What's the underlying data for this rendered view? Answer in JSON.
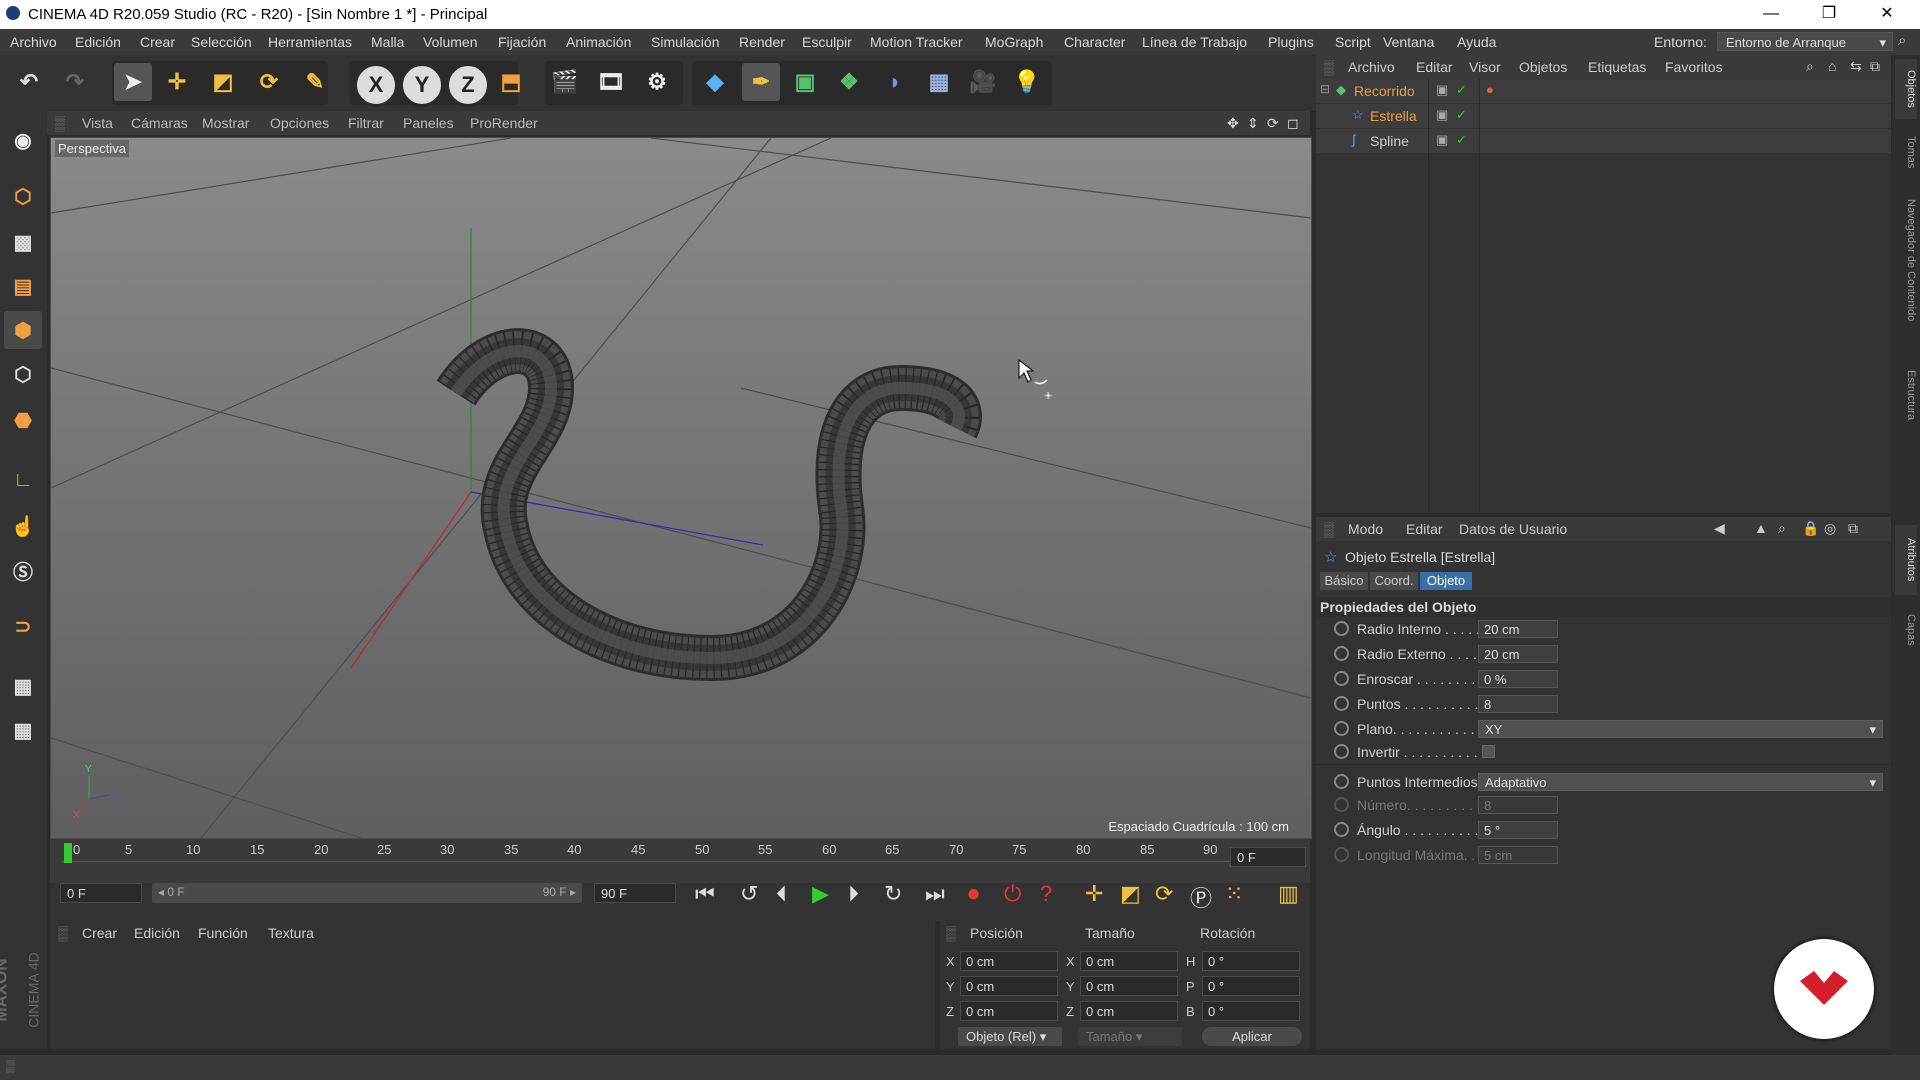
{
  "window": {
    "title": "CINEMA 4D R20.059 Studio (RC - R20) - [Sin Nombre 1 *] - Principal",
    "minimize": "—",
    "restore": "❐",
    "close": "✕"
  },
  "menubar": {
    "items": [
      "Archivo",
      "Edición",
      "Crear",
      "Selección",
      "Herramientas",
      "Malla",
      "Volumen",
      "Fijación",
      "Animación",
      "Simulación",
      "Render",
      "Esculpir",
      "Motion Tracker",
      "MoGraph",
      "Character",
      "Línea de Trabajo",
      "Plugins",
      "Script",
      "Ventana",
      "Ayuda"
    ],
    "env_label": "Entorno:",
    "env_value": "Entorno de Arranque"
  },
  "toolbar": {
    "axis_x": "X",
    "axis_y": "Y",
    "axis_z": "Z"
  },
  "viewport": {
    "menu": [
      "Vista",
      "Cámaras",
      "Mostrar",
      "Opciones",
      "Filtrar",
      "Paneles",
      "ProRender"
    ],
    "camera_label": "Perspectiva",
    "grid_spacing": "Espaciado Cuadrícula : 100 cm",
    "axis_x_label": "X",
    "axis_y_label": "Y",
    "axis_z_label": "Z"
  },
  "timeline": {
    "ticks": [
      "0",
      "5",
      "10",
      "15",
      "20",
      "25",
      "30",
      "35",
      "40",
      "45",
      "50",
      "55",
      "60",
      "65",
      "70",
      "75",
      "80",
      "85",
      "90"
    ],
    "current_frame": "0 F",
    "start_field": "0 F",
    "range_start": "◂ 0 F",
    "range_end": "90 F ▸",
    "end_field": "90 F"
  },
  "material_manager": {
    "menu": [
      "Crear",
      "Edición",
      "Función",
      "Textura"
    ]
  },
  "coordinates": {
    "headers": [
      "Posición",
      "Tamaño",
      "Rotación"
    ],
    "rows": [
      {
        "axis1": "X",
        "pos": "0 cm",
        "axis2": "X",
        "size": "0 cm",
        "axis3": "H",
        "rot": "0 °"
      },
      {
        "axis1": "Y",
        "pos": "0 cm",
        "axis2": "Y",
        "size": "0 cm",
        "axis3": "P",
        "rot": "0 °"
      },
      {
        "axis1": "Z",
        "pos": "0 cm",
        "axis2": "Z",
        "size": "0 cm",
        "axis3": "B",
        "rot": "0 °"
      }
    ],
    "mode_select": "Objeto (Rel)",
    "size_select": "Tamaño",
    "apply": "Aplicar"
  },
  "object_manager": {
    "menu": [
      "Archivo",
      "Editar",
      "Visor",
      "Objetos",
      "Etiquetas",
      "Favoritos"
    ],
    "objects": [
      {
        "name": "Recorrido",
        "color": "#e8a040"
      },
      {
        "name": "Estrella",
        "color": "#e8a040"
      },
      {
        "name": "Spline",
        "color": "#cfcfcf"
      }
    ]
  },
  "attributes": {
    "menu": [
      "Modo",
      "Editar",
      "Datos de Usuario"
    ],
    "object_title": "Objeto Estrella [Estrella]",
    "tabs": [
      "Básico",
      "Coord.",
      "Objeto"
    ],
    "active_tab": "Objeto",
    "section": "Propiedades del Objeto",
    "fields": [
      {
        "label": "Radio Interno . . . . .",
        "value": "20 cm"
      },
      {
        "label": "Radio Externo . . . .",
        "value": "20 cm"
      },
      {
        "label": "Enroscar . . . . . . . . .",
        "value": "0 %"
      },
      {
        "label": "Puntos . . . . . . . . . .",
        "value": "8"
      },
      {
        "label": "Plano. . . . . . . . . . . .",
        "value": "XY"
      },
      {
        "label": "Invertir . . . . . . . . . .",
        "value": ""
      }
    ],
    "intermediate_label": "Puntos Intermedios",
    "intermediate_value": "Adaptativo",
    "sub_fields": [
      {
        "label": "Número. . . . . . . . . .",
        "value": "8",
        "dim": true
      },
      {
        "label": "Ángulo . . . . . . . . . .",
        "value": "5 °",
        "dim": false
      },
      {
        "label": "Longitud Máxima. .",
        "value": "5 cm",
        "dim": true
      }
    ]
  },
  "right_tabs": [
    "Objetos",
    "Tomas",
    "Navegador de Contenido",
    "Estructura",
    "Atributos",
    "Capas"
  ],
  "brand": {
    "line1": "MAXON",
    "line2": "CINEMA 4D"
  }
}
